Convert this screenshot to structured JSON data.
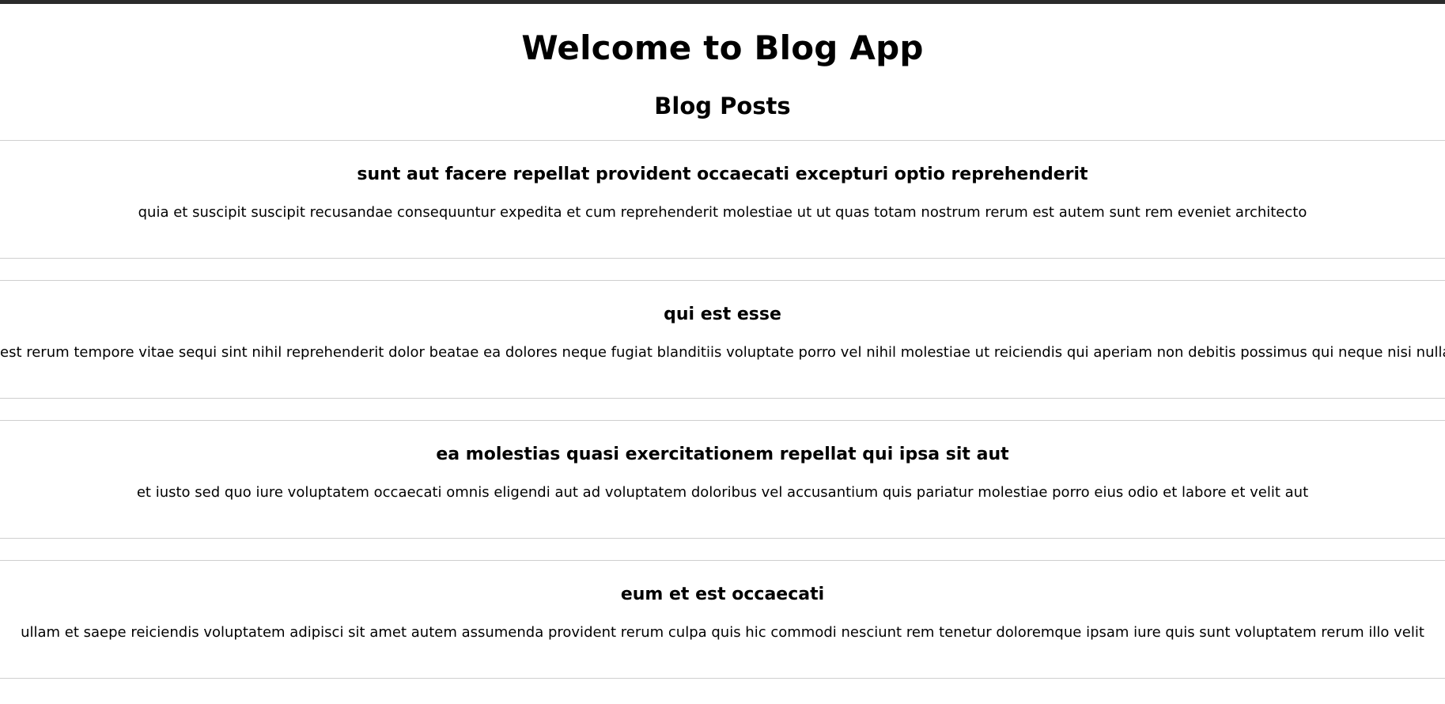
{
  "app": {
    "title": "Welcome to Blog App",
    "section_title": "Blog Posts"
  },
  "posts": [
    {
      "title": "sunt aut facere repellat provident occaecati excepturi optio reprehenderit",
      "body": "quia et suscipit suscipit recusandae consequuntur expedita et cum reprehenderit molestiae ut ut quas totam nostrum rerum est autem sunt rem eveniet architecto"
    },
    {
      "title": "qui est esse",
      "body": "est rerum tempore vitae sequi sint nihil reprehenderit dolor beatae ea dolores neque fugiat blanditiis voluptate porro vel nihil molestiae ut reiciendis qui aperiam non debitis possimus qui neque nisi nulla"
    },
    {
      "title": "ea molestias quasi exercitationem repellat qui ipsa sit aut",
      "body": "et iusto sed quo iure voluptatem occaecati omnis eligendi aut ad voluptatem doloribus vel accusantium quis pariatur molestiae porro eius odio et labore et velit aut"
    },
    {
      "title": "eum et est occaecati",
      "body": "ullam et saepe reiciendis voluptatem adipisci sit amet autem assumenda provident rerum culpa quis hic commodi nesciunt rem tenetur doloremque ipsam iure quis sunt voluptatem rerum illo velit"
    }
  ]
}
